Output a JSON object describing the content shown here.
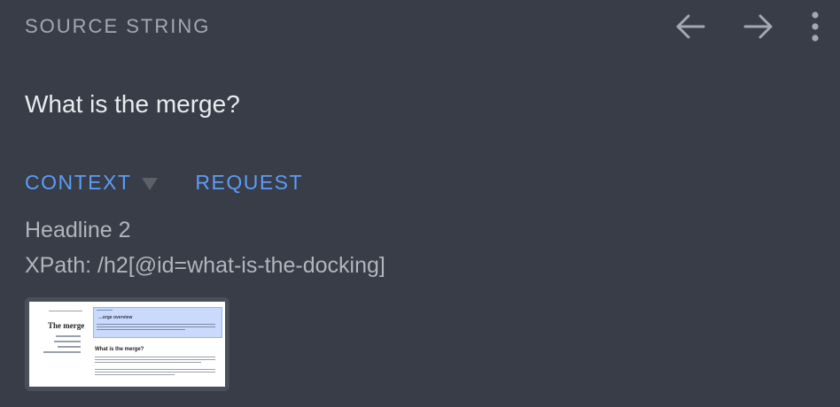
{
  "header": {
    "label": "SOURCE STRING",
    "back_icon": "arrow-left-icon",
    "forward_icon": "arrow-right-icon",
    "more_icon": "more-vertical-icon"
  },
  "source": {
    "text": "What is the merge?"
  },
  "tabs": [
    {
      "label": "CONTEXT",
      "expanded": true
    },
    {
      "label": "REQUEST"
    }
  ],
  "context": {
    "element_type": "Headline 2",
    "xpath": "XPath: /h2[@id=what-is-the-docking]"
  },
  "screenshot": {
    "heading": "The merge",
    "highlight_title": "…erge overview",
    "subheading": "What is the merge?"
  },
  "colors": {
    "background": "#383d48",
    "accent": "#5e9cf5",
    "header_text": "#a4a8b1",
    "source_text": "#e9ebee",
    "context_text": "#b2b5bc"
  }
}
